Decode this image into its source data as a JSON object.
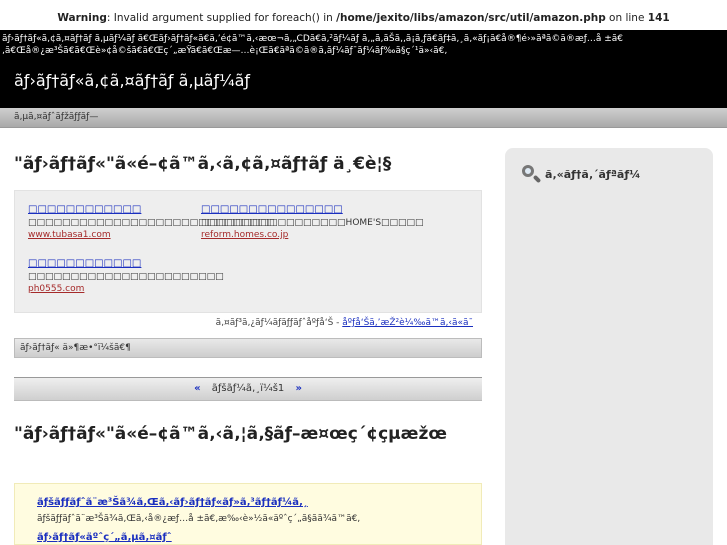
{
  "warning": {
    "label": "Warning",
    "message": ": Invalid argument supplied for foreach() in ",
    "path": "/home/jexito/libs/amazon/src/util/amazon.php",
    "on_line": " on line ",
    "line": "141"
  },
  "header": {
    "description": "ãƒ›ãƒ†ãƒ«ã‚¢ã‚¤ãƒ†ãƒ ã‚µãƒ¼ãƒ  ã€Œãƒ›ãƒ†ãƒ«ã€ã‚’é¢ã™ã‚‹æœ¬ã‚„CDã€ã‚²ãƒ¼ãƒ ã‚„ã‚ãŠã‚‚ã¡ã‚ƒã€ãƒ‡ã‚¸ã‚«ãƒ¡ã€å®¶é›»ãªã©ã®æƒ…å ±ã€‚ã€Œå®¿æ³Šã€ã€Œè»¢å©šã€ã€Œç´„æŸã€ã€Œæ—…è¡Œã€ãªã©ã®ã‚­ãƒ¼ãƒ¯ãƒ¼ãƒ‰ã§ç´¹ä»‹ã€‚",
    "site_title": "ãƒ›ãƒ†ãƒ«ã‚¢ã‚¤ãƒ†ãƒ ã‚µãƒ¼ãƒ"
  },
  "nav": {
    "item": "ã‚µã‚¤ãƒˆãƒžãƒƒãƒ—"
  },
  "main": {
    "heading1": "\"ãƒ›ãƒ†ãƒ«\"ã«é–¢ã™ã‚‹ã‚¢ã‚¤ãƒ†ãƒ ä¸€è¦§",
    "ads": [
      {
        "title": "□□□□□□□□□□□□",
        "text": "□□□□□□□□□□□□□□□□□□□□□□□□□□□□□",
        "url": "www.tubasa1.com"
      },
      {
        "title": "□□□□□□□□□□□□□□□",
        "text": "□□□□□□□□□□□□□□□□□HOME'S□□□□□",
        "url": "reform.homes.co.jp"
      },
      {
        "title": "□□□□□□□□□□□□",
        "text": "□□□□□□□□□□□□□□□□□□□□□□□",
        "url": "ph0555.com"
      }
    ],
    "ads_by_text": "ã‚¤ãƒ³ã‚¿ãƒ¼ãƒãƒƒãƒˆåºƒå‘Š - ",
    "ads_by_link": "åºƒå‘Šã‚’æŽ²è¼‰ã™ã‚‹ã«ã¯",
    "meta_text": "ãƒ›ãƒ†ãƒ« ä»¶æ•°ï¼šã€¶",
    "pager": {
      "prev": "«",
      "current": "ãƒšãƒ¼ã‚¸ï¼š1",
      "next": "»"
    },
    "heading2": "\"ãƒ›ãƒ†ãƒ«\"ã«é–¢ã™ã‚‹ã‚¦ã‚§ãƒ–æ¤œç´¢çµæžœ",
    "posts": [
      {
        "title": "ãƒšãƒƒãƒˆã¨æ³Šã¾ã‚Œã‚‹ãƒ›ãƒ†ãƒ«ãƒ»ã‚³ãƒ†ãƒ¼ã‚¸",
        "text": "ãƒšãƒƒãƒˆã¨æ³Šã¾ã‚Œã‚‹å®¿æƒ…å ±ã€‚æ‰‹è»½ã«äºˆç´„ã§ãã¾ã™ã€‚"
      },
      {
        "title": "ãƒ›ãƒ†ãƒ«äºˆç´„ã‚µã‚¤ãƒˆ",
        "text": ""
      }
    ]
  },
  "sidebar": {
    "search_label": "ã‚«ãƒ†ã‚´ãƒªãƒ¼"
  }
}
